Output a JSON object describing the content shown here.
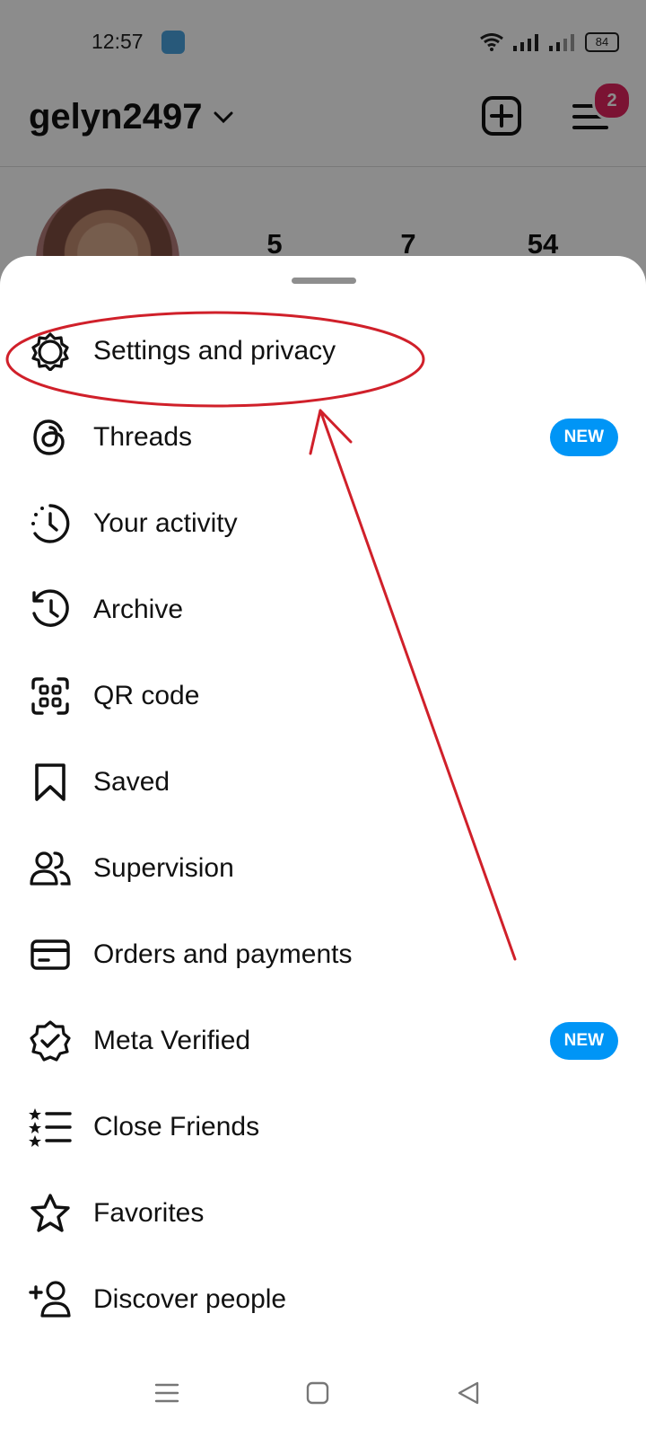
{
  "status_bar": {
    "time": "12:57",
    "battery": "84"
  },
  "header": {
    "username": "gelyn2497",
    "notification_count": "2"
  },
  "profile": {
    "stats": [
      "5",
      "7",
      "54"
    ]
  },
  "menu": {
    "items": [
      {
        "label": "Settings and privacy",
        "icon": "gear-icon"
      },
      {
        "label": "Threads",
        "icon": "threads-icon",
        "badge": "NEW"
      },
      {
        "label": "Your activity",
        "icon": "activity-icon"
      },
      {
        "label": "Archive",
        "icon": "archive-icon"
      },
      {
        "label": "QR code",
        "icon": "qr-code-icon"
      },
      {
        "label": "Saved",
        "icon": "bookmark-icon"
      },
      {
        "label": "Supervision",
        "icon": "supervision-icon"
      },
      {
        "label": "Orders and payments",
        "icon": "card-icon"
      },
      {
        "label": "Meta Verified",
        "icon": "verified-icon",
        "badge": "NEW"
      },
      {
        "label": "Close Friends",
        "icon": "close-friends-icon"
      },
      {
        "label": "Favorites",
        "icon": "star-icon"
      },
      {
        "label": "Discover people",
        "icon": "add-person-icon"
      }
    ]
  },
  "colors": {
    "badge_blue": "#0095f6",
    "notification_red": "#e0245e",
    "annotation_red": "#d0202a"
  }
}
